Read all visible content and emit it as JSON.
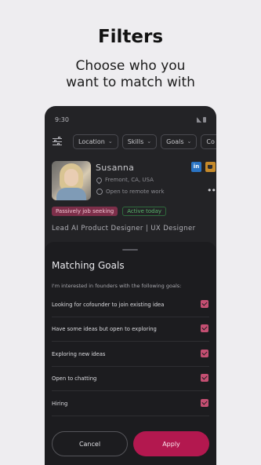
{
  "promo": {
    "title": "Filters",
    "subtitle_line1": "Choose who you",
    "subtitle_line2": "want to match with"
  },
  "status_bar": {
    "time": "9:30"
  },
  "filters": {
    "chips": [
      {
        "label": "Location"
      },
      {
        "label": "Skills"
      },
      {
        "label": "Goals"
      },
      {
        "label": "Co"
      }
    ]
  },
  "profile": {
    "name": "Susanna",
    "location": "Fremont, CA, USA",
    "remote": "Open to remote work",
    "linkedin": "in",
    "badges": {
      "job": "Passively job seeking",
      "activity": "Active today"
    },
    "headline": "Lead AI Product Designer | UX Designer"
  },
  "sheet": {
    "title": "Matching Goals",
    "description": "I'm interested in founders with the following goals:",
    "goals": [
      {
        "label": "Looking for cofounder to join existing idea",
        "checked": true
      },
      {
        "label": "Have some ideas but open to exploring",
        "checked": true
      },
      {
        "label": "Exploring new ideas",
        "checked": true
      },
      {
        "label": "Open to chatting",
        "checked": true
      },
      {
        "label": "Hiring",
        "checked": true
      }
    ],
    "cancel_label": "Cancel",
    "apply_label": "Apply"
  },
  "colors": {
    "accent": "#b3184f",
    "checkbox": "#c44f72",
    "sheet_bg": "#1c1c1f",
    "phone_bg": "#232326",
    "page_bg": "#eeedf0"
  }
}
